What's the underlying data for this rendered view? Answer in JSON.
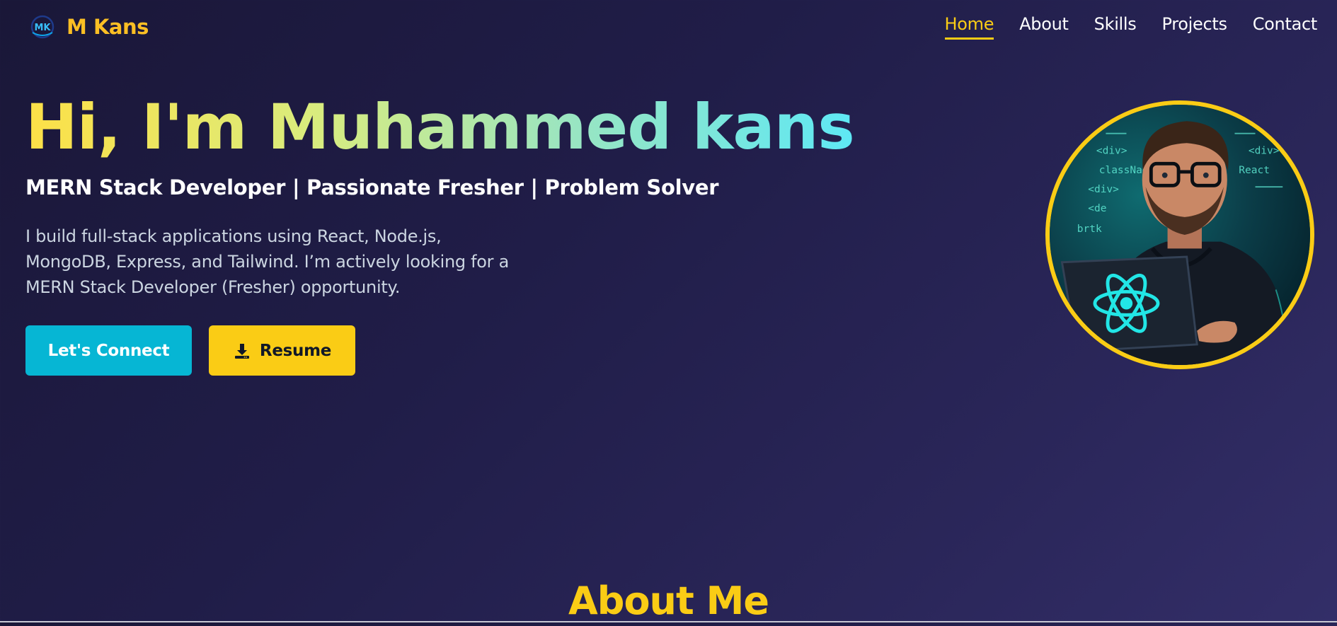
{
  "nav": {
    "brand_name": "M Kans",
    "brand_logo_text": "MK",
    "links": [
      {
        "label": "Home",
        "active": true
      },
      {
        "label": "About",
        "active": false
      },
      {
        "label": "Skills",
        "active": false
      },
      {
        "label": "Projects",
        "active": false
      },
      {
        "label": "Contact",
        "active": false
      }
    ]
  },
  "hero": {
    "title": "Hi, I'm Muhammed kans",
    "subtitle": "MERN Stack Developer | Passionate Fresher | Problem Solver",
    "description": "I build full-stack applications using React, Node.js, MongoDB, Express, and Tailwind. I’m actively looking for a MERN Stack Developer (Fresher) opportunity.",
    "buttons": {
      "connect_label": "Let's Connect",
      "resume_label": "Resume",
      "resume_icon": "download-icon"
    },
    "avatar": {
      "icon": "developer-avatar",
      "code_snippets": [
        "<div>",
        "className",
        "<div>",
        "<de",
        "brtk",
        "<div>",
        "React"
      ]
    }
  },
  "about": {
    "heading": "About Me"
  },
  "colors": {
    "accent_yellow": "#facc15",
    "accent_cyan": "#06b6d4",
    "background": "#201d48"
  }
}
